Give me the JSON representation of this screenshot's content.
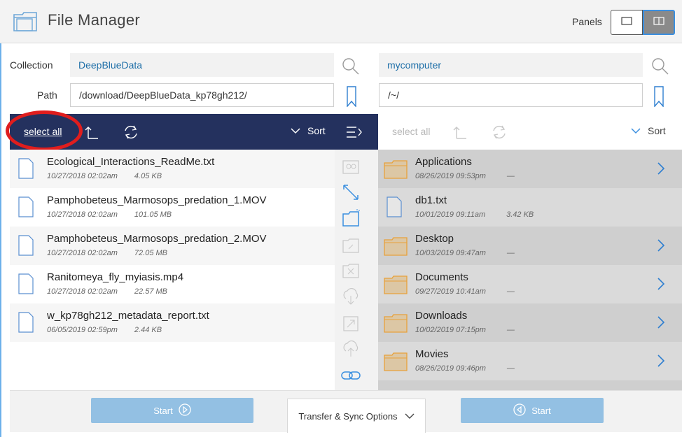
{
  "header": {
    "title": "File Manager",
    "panels_label": "Panels"
  },
  "left": {
    "collection_label": "Collection",
    "collection_value": "DeepBlueData",
    "path_label": "Path",
    "path_value": "/download/DeepBlueData_kp78gh212/",
    "select_all": "select all",
    "sort": "Sort",
    "files": [
      {
        "name": "Ecological_Interactions_ReadMe.txt",
        "date": "10/27/2018 02:02am",
        "size": "4.05 KB"
      },
      {
        "name": "Pamphobeteus_Marmosops_predation_1.MOV",
        "date": "10/27/2018 02:02am",
        "size": "101.05 MB"
      },
      {
        "name": "Pamphobeteus_Marmosops_predation_2.MOV",
        "date": "10/27/2018 02:02am",
        "size": "72.05 MB"
      },
      {
        "name": "Ranitomeya_fly_myiasis.mp4",
        "date": "10/27/2018 02:02am",
        "size": "22.57 MB"
      },
      {
        "name": "w_kp78gh212_metadata_report.txt",
        "date": "06/05/2019 02:59pm",
        "size": "2.44 KB"
      }
    ]
  },
  "right": {
    "collection_value": "mycomputer",
    "path_value": "/~/",
    "select_all": "select all",
    "sort": "Sort",
    "items": [
      {
        "name": "Applications",
        "date": "08/26/2019 09:53pm",
        "size": "—",
        "type": "folder"
      },
      {
        "name": "db1.txt",
        "date": "10/01/2019 09:11am",
        "size": "3.42 KB",
        "type": "file"
      },
      {
        "name": "Desktop",
        "date": "10/03/2019 09:47am",
        "size": "—",
        "type": "folder"
      },
      {
        "name": "Documents",
        "date": "09/27/2019 10:41am",
        "size": "—",
        "type": "folder"
      },
      {
        "name": "Downloads",
        "date": "10/02/2019 07:15pm",
        "size": "—",
        "type": "folder"
      },
      {
        "name": "Movies",
        "date": "08/26/2019 09:46pm",
        "size": "—",
        "type": "folder"
      }
    ]
  },
  "footer": {
    "start_left": "Start",
    "transfer_options": "Transfer & Sync Options",
    "start_right": "Start"
  },
  "colors": {
    "toolbar_dark": "#24315e",
    "accent_blue": "#3a8fe0",
    "folder_orange": "#e8a13a",
    "annotation_red": "#e01d1d",
    "start_button": "#93c0e3"
  }
}
